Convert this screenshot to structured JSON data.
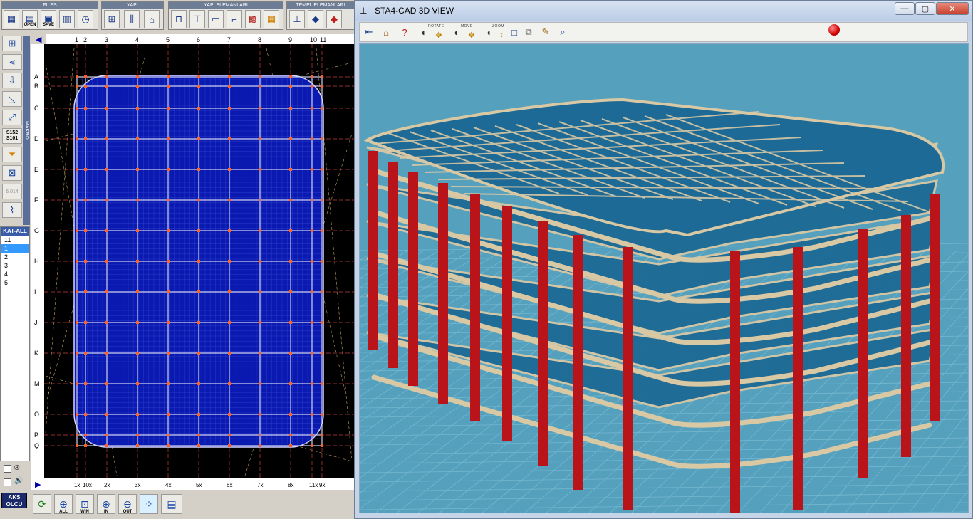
{
  "toolbar": {
    "groups": [
      {
        "title": "FILES",
        "buttons": [
          {
            "icon": "folder-grid-icon",
            "label": ""
          },
          {
            "icon": "open-file-icon",
            "label": "OPEN"
          },
          {
            "icon": "save-file-icon",
            "label": "SAVE"
          },
          {
            "icon": "report-icon",
            "label": ""
          },
          {
            "icon": "clock-file-icon",
            "label": ""
          }
        ]
      },
      {
        "title": "YAPI",
        "buttons": [
          {
            "icon": "frame-icon",
            "label": ""
          },
          {
            "icon": "column-frame-icon",
            "label": ""
          },
          {
            "icon": "structure-icon",
            "label": ""
          }
        ]
      },
      {
        "title": "YAPI ELEMANLARI",
        "buttons": [
          {
            "icon": "beam-icon",
            "label": ""
          },
          {
            "icon": "column-icon",
            "label": ""
          },
          {
            "icon": "slab-icon",
            "label": ""
          },
          {
            "icon": "stair-icon",
            "label": ""
          },
          {
            "icon": "wall-icon",
            "label": ""
          },
          {
            "icon": "grid-pattern-icon",
            "label": ""
          }
        ]
      },
      {
        "title": "TEMEL ELEMANLARI",
        "buttons": [
          {
            "icon": "footing-icon",
            "label": ""
          },
          {
            "icon": "diamond-icon",
            "label": ""
          },
          {
            "icon": "diamond-red-icon",
            "label": ""
          }
        ]
      }
    ]
  },
  "left_toolbar": {
    "makro_label": "MAKRO",
    "buttons": [
      "plan-grid-icon",
      "axis-edit-icon",
      "level-arrow-icon",
      "draw-tool-icon",
      "dimension-icon",
      "section-icon",
      "funnel-icon",
      "copy-grid-icon",
      "disabled-tool-icon",
      "spring-icon"
    ],
    "sub_labels": [
      "",
      "",
      "",
      "",
      "",
      "S152 S101",
      "",
      "",
      "6.014",
      ""
    ]
  },
  "floors": {
    "header": "KAT-ALL",
    "items": [
      "11",
      "1",
      "2",
      "3",
      "4",
      "5"
    ],
    "selected_index": 1
  },
  "bottom_left": {
    "checkbox1_label": "®",
    "checkbox2_label": "🔊",
    "aks_label_line1": "AKS",
    "aks_label_line2": "OLCU"
  },
  "plan": {
    "top_axes": [
      "1",
      "2",
      "3",
      "4",
      "5",
      "6",
      "7",
      "8",
      "9",
      "10",
      "11"
    ],
    "left_axes": [
      "A",
      "B",
      "C",
      "D",
      "E",
      "F",
      "G",
      "H",
      "I",
      "J",
      "K",
      "M",
      "O",
      "P",
      "Q"
    ],
    "bottom_axes": [
      "1x",
      "10x",
      "2x",
      "3x",
      "4x",
      "5x",
      "6x",
      "7x",
      "8x",
      "11x",
      "9x"
    ]
  },
  "bottom_toolbar": {
    "buttons": [
      {
        "icon": "refresh-icon",
        "label": ""
      },
      {
        "icon": "zoom-all-icon",
        "label": "ALL"
      },
      {
        "icon": "zoom-window-icon",
        "label": "WIN"
      },
      {
        "icon": "zoom-in-icon",
        "label": "IN"
      },
      {
        "icon": "zoom-out-icon",
        "label": "OUT"
      },
      {
        "icon": "snap-grid-icon",
        "label": ""
      },
      {
        "icon": "layout-icon",
        "label": ""
      }
    ]
  },
  "view3d": {
    "title": "STA4-CAD  3D VIEW",
    "controls": {
      "minimize": "—",
      "maximize": "▢",
      "close": "✕"
    },
    "labels": {
      "rotate": "ROTATE",
      "move": "MOVE",
      "zoom": "ZOOM"
    },
    "colors": {
      "background": "#55a0bd",
      "column": "#b8141a",
      "beam": "#d8c8a4",
      "slab": "#1d6a96"
    }
  }
}
